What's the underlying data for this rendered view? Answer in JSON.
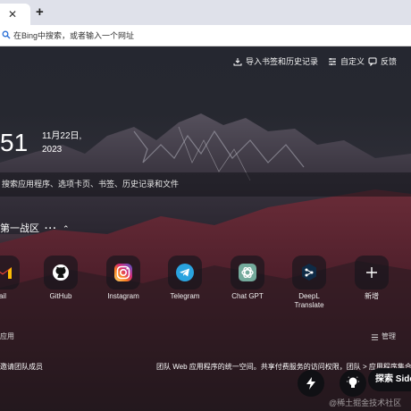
{
  "browser": {
    "tab_close_icon": "✕",
    "new_tab_icon": "+",
    "address_placeholder": "在Bing中搜索，或者输入一个网址"
  },
  "topbar": {
    "import_label": "导入书签和历史记录",
    "customize_label": "自定义",
    "feedback_label": "反馈"
  },
  "clock": {
    "time": "51",
    "date_line1": "11月22日,",
    "date_line2": "2023"
  },
  "search": {
    "placeholder": "搜索应用程序、选项卡页、书签、历史记录和文件"
  },
  "group": {
    "title": "第一战区",
    "more": "···",
    "chevron": "⌃"
  },
  "shortcuts": [
    {
      "label": "ail",
      "icon": "gmail-icon"
    },
    {
      "label": "GitHub",
      "icon": "github-icon"
    },
    {
      "label": "Instagram",
      "icon": "instagram-icon"
    },
    {
      "label": "Telegram",
      "icon": "telegram-icon"
    },
    {
      "label": "Chat GPT",
      "icon": "chatgpt-icon"
    },
    {
      "label": "DeepL\nTranslate",
      "icon": "deepl-icon"
    },
    {
      "label": "新增",
      "icon": "plus-icon"
    }
  ],
  "apps": {
    "section_label": "应用",
    "manage_label": "管理"
  },
  "bottom": {
    "invite_label": "邀请团队成员",
    "promo_text": "团队 Web 应用程序的统一空间。共享付费服务的访问权限，团队 > 应用程序集合",
    "explore_label": "探索 Side",
    "watermark": "@稀土掘金技术社区"
  }
}
